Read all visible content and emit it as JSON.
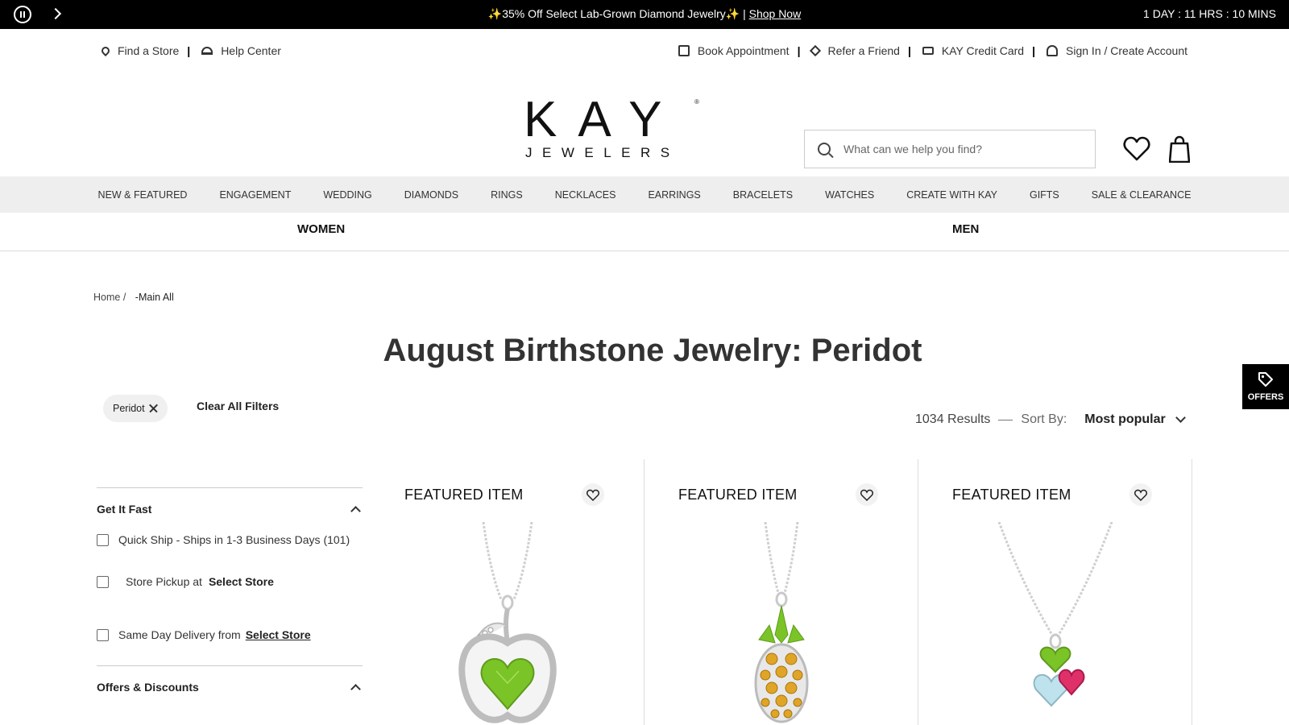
{
  "promo": {
    "message": "✨35% Off Select Lab-Grown Diamond Jewelry✨ |",
    "link": "Shop Now",
    "countdown": "1 DAY : 11 HRS : 10 MINS"
  },
  "utility": {
    "left": [
      "Find a Store",
      "Help Center"
    ],
    "right": [
      "Book Appointment",
      "Refer a Friend",
      "KAY Credit Card",
      "Sign In / Create Account"
    ]
  },
  "logo": {
    "main": "KAY",
    "sub": "JEWELERS",
    "reg": "®"
  },
  "search": {
    "placeholder": "What can we help you find?"
  },
  "nav": [
    "NEW & FEATURED",
    "ENGAGEMENT",
    "WEDDING",
    "DIAMONDS",
    "RINGS",
    "NECKLACES",
    "EARRINGS",
    "BRACELETS",
    "WATCHES",
    "CREATE WITH KAY",
    "GIFTS",
    "SALE & CLEARANCE"
  ],
  "gender": [
    "WOMEN",
    "MEN"
  ],
  "breadcrumb": {
    "home": "Home",
    "sep": "/",
    "current": "-Main All"
  },
  "page_title": "August Birthstone Jewelry: Peridot",
  "active_filter": "Peridot",
  "clear_filters": "Clear All Filters",
  "results": {
    "count": "1034 Results",
    "sort_label": "Sort By:",
    "sort_value": "Most popular"
  },
  "filters": {
    "get_it_fast": "Get It Fast",
    "quick_ship": "Quick Ship - Ships in 1-3 Business Days (101)",
    "store_pickup": "Store Pickup at",
    "select_store": "Select Store",
    "same_day": "Same Day Delivery from",
    "offers": "Offers & Discounts"
  },
  "offers_tab": "OFFERS",
  "products": [
    {
      "badge": "FEATURED ITEM",
      "image": "apple-pendant"
    },
    {
      "badge": "FEATURED ITEM",
      "image": "pineapple-pendant"
    },
    {
      "badge": "FEATURED ITEM",
      "image": "gemstone-cluster-pendant"
    }
  ],
  "colors": {
    "promo_bg": "#000000",
    "nav_bg": "#eeeeee",
    "peridot": "#7ac427",
    "citrine": "#e0a526",
    "pink": "#e0306a",
    "aqua": "#bfe3ee"
  }
}
